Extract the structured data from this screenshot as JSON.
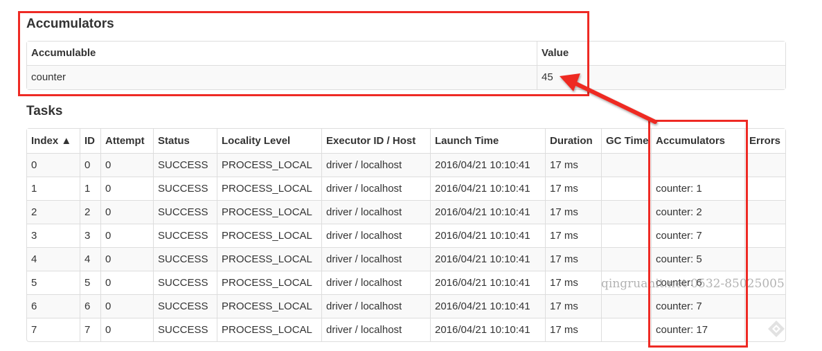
{
  "accumulators_section": {
    "title": "Accumulators",
    "headers": [
      "Accumulable",
      "Value"
    ],
    "rows": [
      [
        "counter",
        "45"
      ]
    ]
  },
  "tasks_section": {
    "title": "Tasks",
    "headers": [
      "Index ▲",
      "ID",
      "Attempt",
      "Status",
      "Locality Level",
      "Executor ID / Host",
      "Launch Time",
      "Duration",
      "GC Time",
      "Accumulators",
      "Errors"
    ],
    "rows": [
      [
        "0",
        "0",
        "0",
        "SUCCESS",
        "PROCESS_LOCAL",
        "driver / localhost",
        "2016/04/21 10:10:41",
        "17 ms",
        "",
        "",
        ""
      ],
      [
        "1",
        "1",
        "0",
        "SUCCESS",
        "PROCESS_LOCAL",
        "driver / localhost",
        "2016/04/21 10:10:41",
        "17 ms",
        "",
        "counter: 1",
        ""
      ],
      [
        "2",
        "2",
        "0",
        "SUCCESS",
        "PROCESS_LOCAL",
        "driver / localhost",
        "2016/04/21 10:10:41",
        "17 ms",
        "",
        "counter: 2",
        ""
      ],
      [
        "3",
        "3",
        "0",
        "SUCCESS",
        "PROCESS_LOCAL",
        "driver / localhost",
        "2016/04/21 10:10:41",
        "17 ms",
        "",
        "counter: 7",
        ""
      ],
      [
        "4",
        "4",
        "0",
        "SUCCESS",
        "PROCESS_LOCAL",
        "driver / localhost",
        "2016/04/21 10:10:41",
        "17 ms",
        "",
        "counter: 5",
        ""
      ],
      [
        "5",
        "5",
        "0",
        "SUCCESS",
        "PROCESS_LOCAL",
        "driver / localhost",
        "2016/04/21 10:10:41",
        "17 ms",
        "",
        "counter: 6",
        ""
      ],
      [
        "6",
        "6",
        "0",
        "SUCCESS",
        "PROCESS_LOCAL",
        "driver / localhost",
        "2016/04/21 10:10:41",
        "17 ms",
        "",
        "counter: 7",
        ""
      ],
      [
        "7",
        "7",
        "0",
        "SUCCESS",
        "PROCESS_LOCAL",
        "driver / localhost",
        "2016/04/21 10:10:41",
        "17 ms",
        "",
        "counter: 17",
        ""
      ]
    ]
  },
  "watermark": "qingruanit.net 0532-85025005",
  "colors": {
    "annotation_red": "#ee2a24",
    "table_border": "#dddddd",
    "row_stripe": "#f9f9f9",
    "text": "#333333"
  },
  "icons": {
    "corner": "diamond-logo-icon"
  }
}
